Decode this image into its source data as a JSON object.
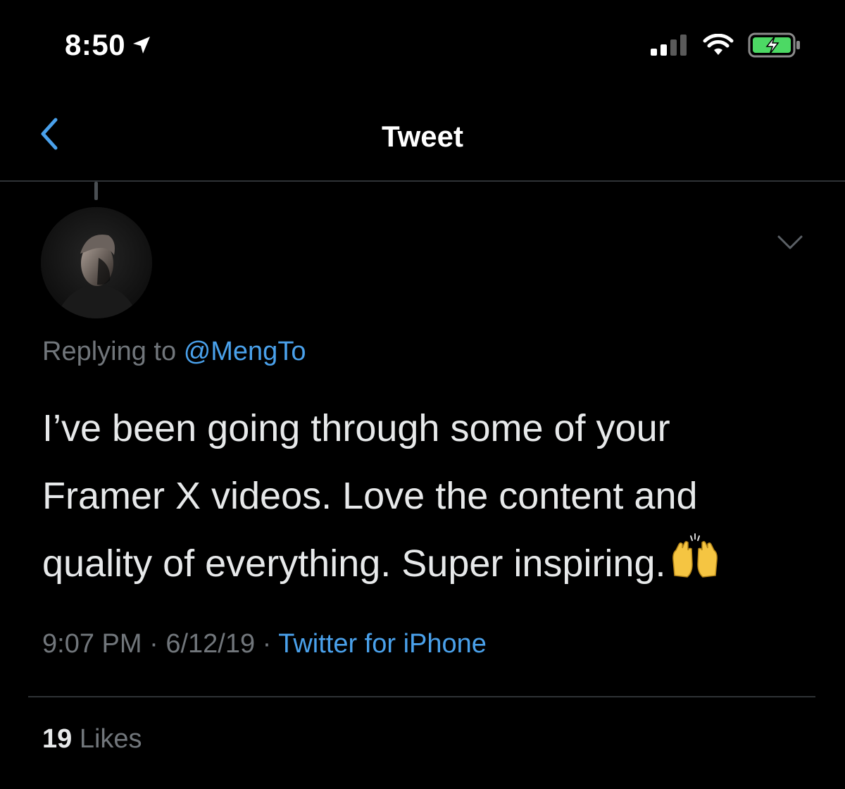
{
  "status_bar": {
    "time": "8:50",
    "icons": [
      "location-arrow-icon",
      "cellular-signal-icon",
      "wifi-icon",
      "battery-charging-icon"
    ]
  },
  "nav": {
    "title": "Tweet",
    "back_icon": "chevron-left-icon"
  },
  "tweet": {
    "replying_prefix": "Replying to",
    "replying_handle": "@MengTo",
    "text_lines": [
      "I’ve been going through some of your",
      "Framer X videos. Love the content and",
      "quality of everything. Super inspiring."
    ],
    "emoji": "raising-hands-emoji",
    "time": "9:07 PM",
    "sep1": " · ",
    "date": "6/12/19",
    "sep2": " · ",
    "source": "Twitter for iPhone",
    "likes_count": "19",
    "likes_label": "Likes"
  },
  "colors": {
    "background": "#000000",
    "accent": "#4aa1eb",
    "secondary_text": "#71767b",
    "primary_text": "#e7e9ea",
    "battery_green": "#4cd964"
  }
}
